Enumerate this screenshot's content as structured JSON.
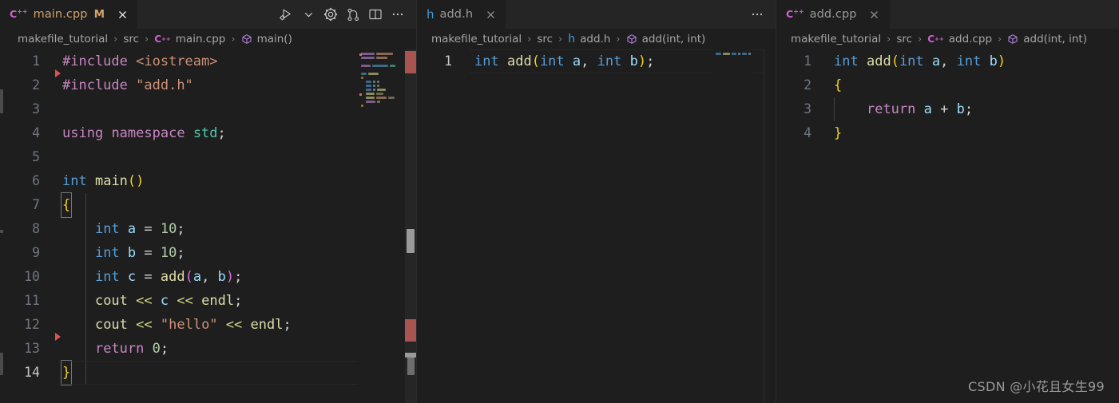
{
  "groups": [
    {
      "id": "main-cpp",
      "tab": {
        "icon": "cpp-file-icon",
        "icon_glyph": "C↔",
        "label": "main.cpp",
        "dirty_mark": "M",
        "close_icon": "close-icon"
      },
      "actions": [
        {
          "name": "run-and-debug-icon",
          "label": "Run or Debug"
        },
        {
          "name": "chevron-down-icon",
          "label": "More run options"
        },
        {
          "name": "gear-icon",
          "label": "Settings"
        },
        {
          "name": "source-control-icon",
          "label": "Source Control"
        },
        {
          "name": "split-editor-icon",
          "label": "Split Editor"
        },
        {
          "name": "more-actions-icon",
          "label": "More Actions..."
        }
      ],
      "breadcrumb": [
        {
          "text": "makefile_tutorial",
          "icon": ""
        },
        {
          "text": "src",
          "icon": ""
        },
        {
          "text": "main.cpp",
          "icon": "cpp-file-icon"
        },
        {
          "text": "main()",
          "icon": "symbol-function-icon"
        }
      ],
      "lines": [
        {
          "n": "1",
          "text": "#include <iostream>"
        },
        {
          "n": "2",
          "text": "#include \"add.h\""
        },
        {
          "n": "3",
          "text": ""
        },
        {
          "n": "4",
          "text": "using namespace std;"
        },
        {
          "n": "5",
          "text": ""
        },
        {
          "n": "6",
          "text": "int main()"
        },
        {
          "n": "7",
          "text": "{"
        },
        {
          "n": "8",
          "text": "    int a = 10;"
        },
        {
          "n": "9",
          "text": "    int b = 10;"
        },
        {
          "n": "10",
          "text": "    int c = add(a, b);"
        },
        {
          "n": "11",
          "text": "    cout << c << endl;"
        },
        {
          "n": "12",
          "text": "    cout << \"hello\" << endl;"
        },
        {
          "n": "13",
          "text": "    return 0;"
        },
        {
          "n": "14",
          "text": "}"
        }
      ],
      "active_line": "14"
    },
    {
      "id": "add-h",
      "tab": {
        "icon": "h-file-icon",
        "icon_glyph": "h",
        "label": "add.h",
        "dirty_mark": "",
        "close_icon": "close-icon"
      },
      "actions": [
        {
          "name": "more-actions-icon",
          "label": "More Actions..."
        }
      ],
      "breadcrumb": [
        {
          "text": "makefile_tutorial",
          "icon": ""
        },
        {
          "text": "src",
          "icon": ""
        },
        {
          "text": "add.h",
          "icon": "h-file-icon"
        },
        {
          "text": "add(int, int)",
          "icon": "symbol-function-icon"
        }
      ],
      "lines": [
        {
          "n": "1",
          "text": "int add(int a, int b);"
        }
      ],
      "active_line": "1"
    },
    {
      "id": "add-cpp",
      "tab": {
        "icon": "cpp-file-icon",
        "icon_glyph": "C↔",
        "label": "add.cpp",
        "dirty_mark": "",
        "close_icon": "close-icon"
      },
      "actions": [],
      "breadcrumb": [
        {
          "text": "makefile_tutorial",
          "icon": ""
        },
        {
          "text": "src",
          "icon": ""
        },
        {
          "text": "add.cpp",
          "icon": "cpp-file-icon"
        },
        {
          "text": "add(int, int)",
          "icon": "symbol-function-icon"
        }
      ],
      "lines": [
        {
          "n": "1",
          "text": "int add(int a, int b)"
        },
        {
          "n": "2",
          "text": "{"
        },
        {
          "n": "3",
          "text": "    return a + b;"
        },
        {
          "n": "4",
          "text": "}"
        }
      ],
      "active_line": ""
    }
  ],
  "watermark": "CSDN @小花且女生99",
  "colors": {
    "editor_background": "#1e1e1e",
    "tabbar_background": "#252526",
    "dirty_tab_foreground": "#d2a269",
    "line_number": "#6e7681",
    "active_line_number": "#c6c6c6",
    "breakpoint_marker": "#e05252",
    "keyword": "#c586c0",
    "type": "#569cd6",
    "function": "#dcdcaa",
    "variable": "#9cdcfe",
    "number": "#b5cea8",
    "string": "#ce9178",
    "bracket_yellow": "#f2d024",
    "bracket_magenta": "#da70d6"
  }
}
